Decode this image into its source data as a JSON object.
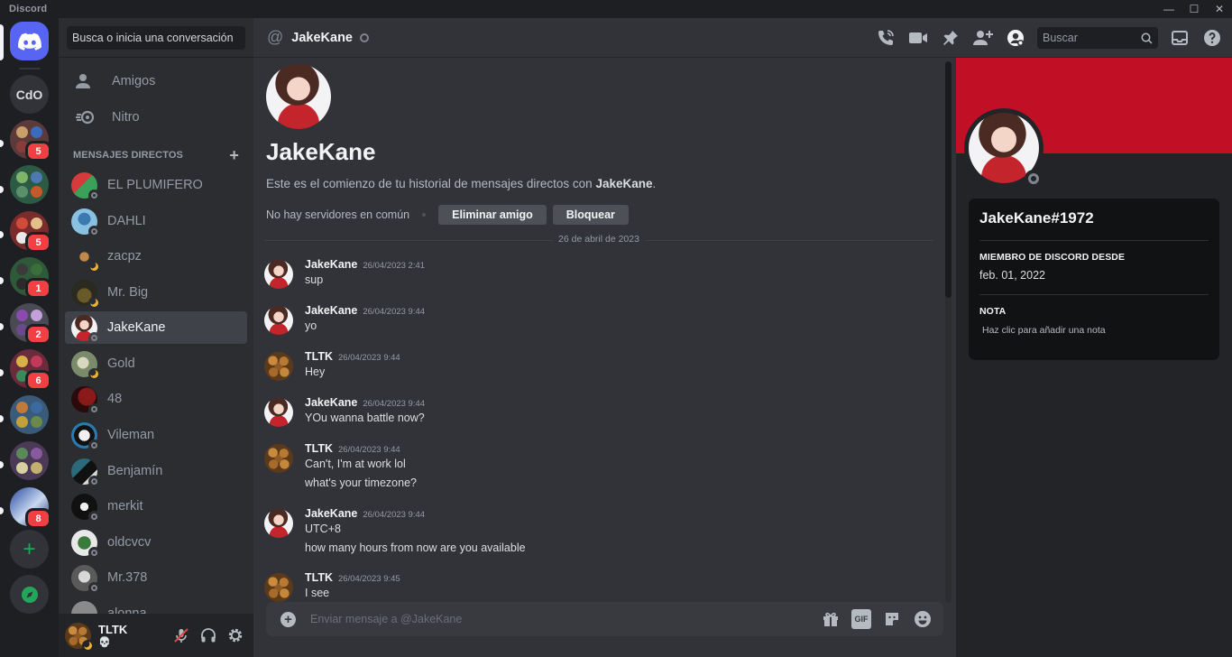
{
  "window": {
    "app_name": "Discord",
    "minimize": "—",
    "maximize": "☐",
    "close": "✕"
  },
  "rail": {
    "home_label": "Discord",
    "servers": [
      {
        "name": "CdO",
        "badge": ""
      },
      {
        "name": "server-2",
        "badge": "5"
      },
      {
        "name": "server-3",
        "badge": ""
      },
      {
        "name": "server-4",
        "badge": "5"
      },
      {
        "name": "server-5",
        "badge": "1"
      },
      {
        "name": "server-6",
        "badge": "2"
      },
      {
        "name": "server-7",
        "badge": "6"
      },
      {
        "name": "server-8",
        "badge": ""
      },
      {
        "name": "server-9",
        "badge": ""
      },
      {
        "name": "server-10",
        "badge": "8"
      }
    ],
    "add_server": "+",
    "explore": "explore-icon"
  },
  "dm_sidebar": {
    "search_placeholder": "Busca o inicia una conversación",
    "nav": [
      {
        "label": "Amigos"
      },
      {
        "label": "Nitro"
      }
    ],
    "section_title": "MENSAJES DIRECTOS",
    "section_add": "+",
    "dms": [
      {
        "name": "EL PLUMIFERO",
        "status": "offline"
      },
      {
        "name": "DAHLI",
        "status": "offline"
      },
      {
        "name": "zacpz",
        "status": "idle"
      },
      {
        "name": "Mr. Big",
        "status": "idle"
      },
      {
        "name": "JakeKane",
        "status": "offline",
        "active": true
      },
      {
        "name": "Gold",
        "status": "idle"
      },
      {
        "name": "48",
        "status": "offline"
      },
      {
        "name": "Vileman",
        "status": "offline"
      },
      {
        "name": "Benjamín",
        "status": "offline"
      },
      {
        "name": "merkit",
        "status": "offline"
      },
      {
        "name": "oldcvcv",
        "status": "offline"
      },
      {
        "name": "Mr.378",
        "status": "offline"
      },
      {
        "name": "alonna",
        "status": "offline"
      }
    ]
  },
  "user_panel": {
    "username": "TLTK",
    "status_glyph": "💀"
  },
  "chat": {
    "recipient": "JakeKane",
    "search_placeholder": "Buscar",
    "intro_name": "JakeKane",
    "intro_prefix": "Este es el comienzo de tu historial de mensajes directos con ",
    "intro_user": "JakeKane",
    "intro_suffix": ".",
    "no_servers": "No hay servidores en común",
    "remove_friend": "Eliminar amigo",
    "block": "Bloquear",
    "date_divider": "26 de abril de 2023",
    "messages": [
      {
        "author": "JakeKane",
        "time": "26/04/2023 2:41",
        "lines": [
          "sup"
        ]
      },
      {
        "author": "JakeKane",
        "time": "26/04/2023 9:44",
        "lines": [
          "yo"
        ]
      },
      {
        "author": "TLTK",
        "time": "26/04/2023 9:44",
        "lines": [
          "Hey"
        ]
      },
      {
        "author": "JakeKane",
        "time": "26/04/2023 9:44",
        "lines": [
          "YOu wanna battle now?"
        ]
      },
      {
        "author": "TLTK",
        "time": "26/04/2023 9:44",
        "lines": [
          "Can't, I'm at work lol",
          "what's your timezone?"
        ]
      },
      {
        "author": "JakeKane",
        "time": "26/04/2023 9:44",
        "lines": [
          "UTC+8",
          "how many hours from now are you available"
        ]
      },
      {
        "author": "TLTK",
        "time": "26/04/2023 9:45",
        "lines": [
          "I see"
        ]
      }
    ],
    "composer_placeholder": "Enviar mensaje a @JakeKane",
    "composer_gif": "GIF"
  },
  "profile": {
    "tag": "JakeKane#1972",
    "member_since_label": "MIEMBRO DE DISCORD DESDE",
    "member_since": "feb. 01, 2022",
    "note_label": "NOTA",
    "note_placeholder": "Haz clic para añadir una nota"
  },
  "colors": {
    "blurple": "#5865f2",
    "banner": "#c11025",
    "green": "#23a55a",
    "badge_red": "#f23f43"
  }
}
